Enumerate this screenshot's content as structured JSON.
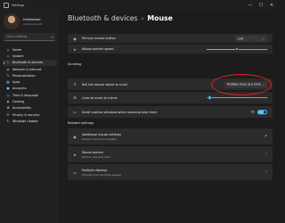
{
  "window": {
    "title": "Settings",
    "controls": [
      "—",
      "☐",
      "✕"
    ]
  },
  "profile": {
    "name": "fredbaxter",
    "sub": "Local Account"
  },
  "search": {
    "placeholder": "Find a setting"
  },
  "nav": [
    {
      "label": "Home",
      "icon": "home-icon",
      "glyph": "⌂"
    },
    {
      "label": "System",
      "icon": "display-icon",
      "glyph": "▭"
    },
    {
      "label": "Bluetooth & devices",
      "icon": "bluetooth-icon",
      "glyph": "ᛒ",
      "active": true
    },
    {
      "label": "Network & internet",
      "icon": "wifi-icon",
      "glyph": "◈"
    },
    {
      "label": "Personalization",
      "icon": "brush-icon",
      "glyph": "✎"
    },
    {
      "label": "Apps",
      "icon": "apps-icon",
      "glyph": "▦"
    },
    {
      "label": "Accounts",
      "icon": "person-icon",
      "glyph": "●"
    },
    {
      "label": "Time & language",
      "icon": "globe-clock-icon",
      "glyph": "◷"
    },
    {
      "label": "Gaming",
      "icon": "gamepad-icon",
      "glyph": "♟"
    },
    {
      "label": "Accessibility",
      "icon": "accessibility-icon",
      "glyph": "✱"
    },
    {
      "label": "Privacy & security",
      "icon": "shield-icon",
      "glyph": "⛨"
    },
    {
      "label": "Windows Update",
      "icon": "update-icon",
      "glyph": "↻"
    }
  ],
  "breadcrumb": {
    "parent": "Bluetooth & devices",
    "separator": "›",
    "current": "Mouse"
  },
  "settings": {
    "primary_button": {
      "label": "Primary mouse button",
      "value": "Left"
    },
    "pointer_speed": {
      "label": "Mouse pointer speed",
      "level": 0.5
    },
    "scrolling_header": "Scrolling",
    "wheel_scroll": {
      "label": "Roll the mouse wheel to scroll",
      "value": "Multiple lines at a time"
    },
    "lines_scroll": {
      "label": "Lines to scroll at a time",
      "level": 0.05
    },
    "inactive_scroll": {
      "label": "Scroll inactive windows when hovering over them",
      "toggle_label": "On",
      "on": true
    },
    "related_header": "Related settings",
    "related": [
      {
        "title": "Additional mouse settings",
        "sub": "Pointer icons and visibility",
        "icon": "mouse-icon",
        "glyph": "◉",
        "action": "↗"
      },
      {
        "title": "Mouse pointer",
        "sub": "Pointer size and color",
        "icon": "pointer-icon",
        "glyph": "➤",
        "action": "›"
      },
      {
        "title": "Multiple displays",
        "sub": "Change how windows appear",
        "icon": "display-icon",
        "glyph": "▭",
        "action": "›"
      }
    ]
  },
  "colors": {
    "accent": "#4cc2ff",
    "annotation": "#e02020"
  }
}
